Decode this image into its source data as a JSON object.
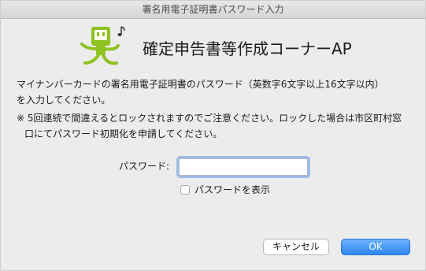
{
  "window": {
    "title": "署名用電子証明書パスワード入力"
  },
  "header": {
    "app_title": "確定申告書等作成コーナーAP",
    "logo_icon": "mascot-logo-icon",
    "logo_color": "#8dc21f"
  },
  "message": {
    "line1": "マイナンバーカードの署名用電子証明書のパスワード（英数字6文字以上16文字以内）",
    "line2": "を入力してください。"
  },
  "note": {
    "line1": "※ 5回連続で間違えるとロックされますのでご注意ください。ロックした場合は市区町村窓",
    "line2": "口にてパスワード初期化を申請してください。"
  },
  "form": {
    "password_label": "パスワード:",
    "password_value": "",
    "show_password_label": "パスワードを表示",
    "show_password_checked": false
  },
  "buttons": {
    "cancel_label": "キャンセル",
    "ok_label": "OK",
    "ok_color": "#2f86f7"
  }
}
